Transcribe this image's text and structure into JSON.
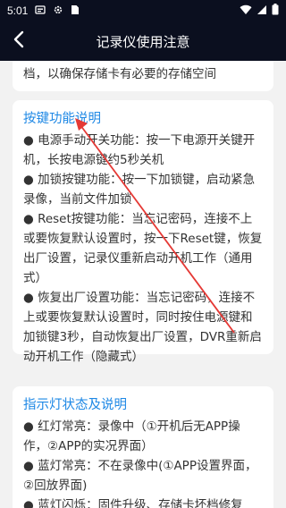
{
  "status_bar": {
    "time": "5:01"
  },
  "header": {
    "title": "记录仪使用注意"
  },
  "top_card": {
    "text": "档，以确保存储卡有必要的存储空间"
  },
  "button_card": {
    "title": "按键功能说明",
    "items": [
      "● 电源手动开关功能：按一下电源开关键开机，长按电源键约5秒关机",
      "● 加锁按键功能：按一下加锁键，启动紧急录像，当前文件加锁",
      "● Reset按键功能：当忘记密码，连接不上或要恢复默认设置时，按一下Reset键，恢复出厂设置，记录仪重新启动开机工作（通用式）",
      "● 恢复出厂设置功能：当忘记密码，连接不上或要恢复默认设置时，同时按住电源键和加锁键3秒，自动恢复出厂设置，DVR重新启动开机工作（隐藏式）"
    ]
  },
  "indicator_card": {
    "title": "指示灯状态及说明",
    "items": [
      "● 红灯常亮：录像中（①开机后无APP操作，②APP的实况界面）",
      "● 蓝灯常亮：不在录像中(①APP设置界面，②回放界面)",
      "● 蓝灯闪烁：固件升级、存储卡坏档修复"
    ]
  },
  "colors": {
    "accent": "#1e88e5",
    "header_bg": "#0b0f1f",
    "annotation": "#e53935"
  },
  "icons": [
    "notification-icon",
    "settings-icon",
    "sim-icon",
    "wifi-icon",
    "signal-icon",
    "battery-icon",
    "back-arrow-icon"
  ]
}
